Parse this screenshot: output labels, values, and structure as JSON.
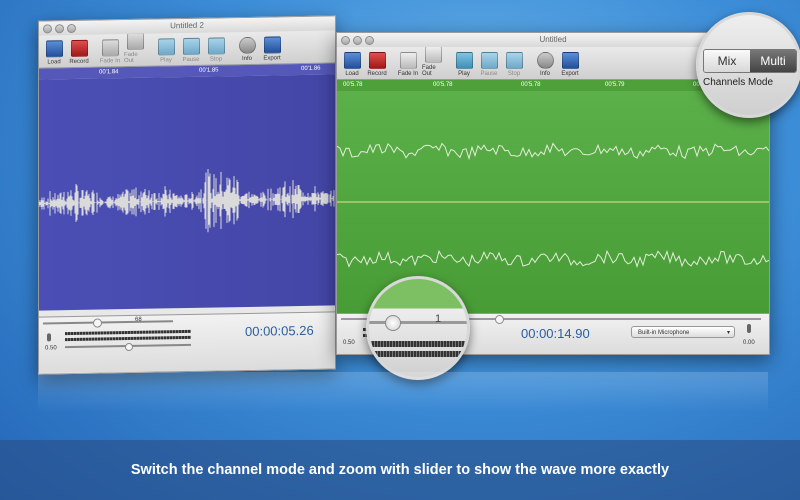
{
  "window_left": {
    "title": "Untitled 2",
    "toolbar": [
      {
        "label": "Load",
        "icon": "waveform-icon"
      },
      {
        "label": "Record",
        "icon": "record-icon"
      },
      {
        "label": "Fade In",
        "icon": "fade-in-icon"
      },
      {
        "label": "Fade Out",
        "icon": "fade-out-icon"
      },
      {
        "label": "Play",
        "icon": "play-icon"
      },
      {
        "label": "Pause",
        "icon": "pause-icon"
      },
      {
        "label": "Stop",
        "icon": "stop-icon"
      },
      {
        "label": "Info",
        "icon": "info-icon"
      },
      {
        "label": "Export",
        "icon": "export-icon"
      }
    ],
    "ruler": [
      "00'1.84",
      "00'1.85",
      "00'1.86"
    ],
    "zoom_value": "68",
    "volume": "0.50",
    "time": "00:00:05.26",
    "wave_color": "#4a4fb0"
  },
  "window_right": {
    "title": "Untitled",
    "toolbar": [
      {
        "label": "Load",
        "icon": "waveform-icon"
      },
      {
        "label": "Record",
        "icon": "record-icon"
      },
      {
        "label": "Fade In",
        "icon": "fade-in-icon"
      },
      {
        "label": "Fade Out",
        "icon": "fade-out-icon"
      },
      {
        "label": "Play",
        "icon": "play-icon"
      },
      {
        "label": "Pause",
        "icon": "pause-icon"
      },
      {
        "label": "Stop",
        "icon": "stop-icon"
      },
      {
        "label": "Info",
        "icon": "info-icon"
      },
      {
        "label": "Export",
        "icon": "export-icon"
      }
    ],
    "ruler": [
      "00'5.78",
      "00'5.78",
      "00'5.78",
      "00'5.79",
      "00'5.79"
    ],
    "volume": "0.50",
    "time": "00:00:14.90",
    "input_device": "Built-in Microphone",
    "level": "0.00",
    "wave_color": "#4ea63a"
  },
  "channels_magnifier": {
    "mix_label": "Mix",
    "multi_label": "Multi",
    "caption": "Channels Mode"
  },
  "slider_magnifier": {
    "value": "1"
  },
  "caption": "Switch the channel mode and zoom with slider to show the wave more exactly"
}
